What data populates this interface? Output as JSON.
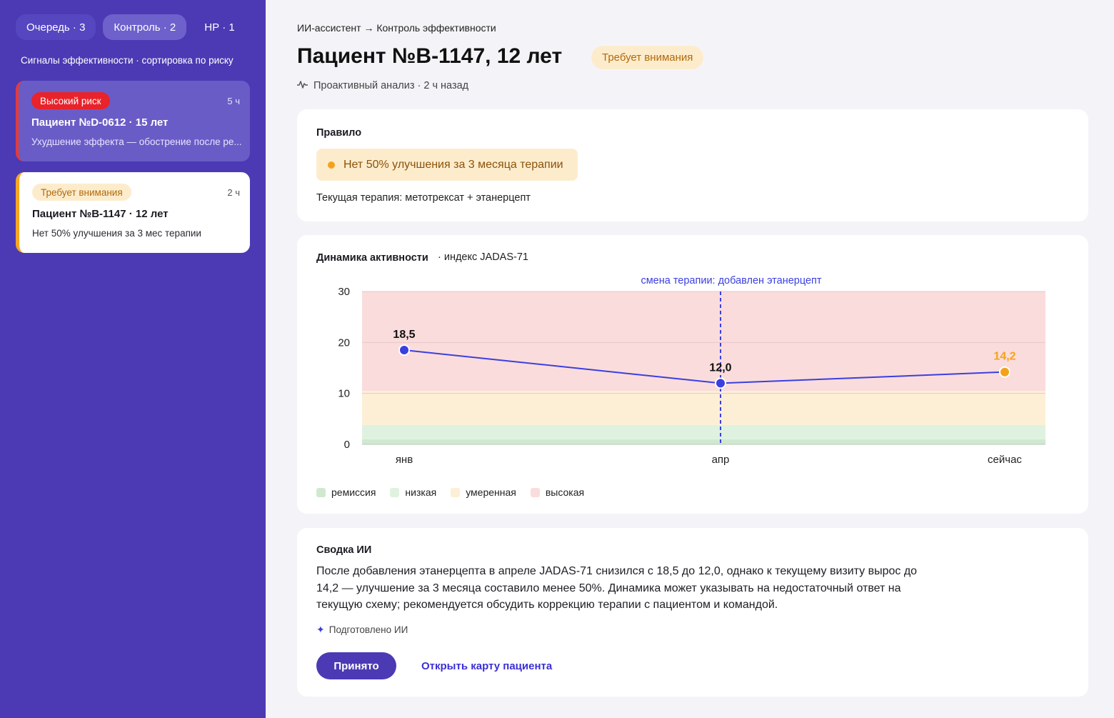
{
  "sidebar": {
    "tabs": [
      {
        "label": "Очередь · 3"
      },
      {
        "label": "Контроль · 2"
      },
      {
        "label": "НР · 1"
      }
    ],
    "subtitle": "Сигналы эффективности · сортировка по риску",
    "cards": [
      {
        "badge": "Высокий риск",
        "time": "5 ч",
        "title": "Пациент №D-0612 · 15 лет",
        "desc": "Ухудшение эффекта — обострение после ре..."
      },
      {
        "badge": "Требует внимания",
        "time": "2 ч",
        "title": "Пациент №B-1147 · 12 лет",
        "desc": "Нет 50% улучшения за 3 мес терапии"
      }
    ]
  },
  "main": {
    "breadcrumb": "ИИ-ассистент → Контроль эффективности",
    "title": "Пациент №B-1147, 12 лет",
    "status_badge": "Требует внимания",
    "analysis": "Проактивный анализ · 2 ч назад",
    "rule": {
      "heading": "Правило",
      "text": "Нет 50% улучшения за 3 месяца терапии",
      "therapy": "Текущая терапия: метотрексат + этанерцепт"
    },
    "chart_panel": {
      "heading": "Динамика активности",
      "subheading": "· индекс JADAS-71"
    },
    "summary": {
      "heading": "Сводка ИИ",
      "text": "После добавления этанерцепта в апреле JADAS-71 снизился с 18,5 до 12,0, однако к текущему визиту вырос до 14,2 — улучшение за 3 месяца составило менее 50%. Динамика может указывать на недостаточный ответ на текущую схему; рекомендуется обсудить коррекцию терапии с пациентом и командой.",
      "note": "Подготовлено ИИ",
      "accept_label": "Принято",
      "open_label": "Открыть карту пациента"
    }
  },
  "colors": {
    "sidebar": "#4b3ab4",
    "accent": "#3b3fe0",
    "warning": "#f5a21b",
    "danger": "#e8232a"
  },
  "chart_data": {
    "type": "line",
    "title": "Динамика активности",
    "ylabel": "",
    "xlabel": "",
    "categories": [
      "янв",
      "апр",
      "сейчас"
    ],
    "values": [
      18.5,
      12.0,
      14.2
    ],
    "value_labels": [
      "18,5",
      "12,0",
      "14,2"
    ],
    "ylim": [
      0,
      30
    ],
    "yticks": [
      "0",
      "10",
      "20",
      "30"
    ],
    "bands": [
      {
        "name": "ремиссия",
        "from": 0,
        "to": 1,
        "color": "#cfe9cf"
      },
      {
        "name": "низкая",
        "from": 1,
        "to": 3.8,
        "color": "#dff2e0"
      },
      {
        "name": "умеренная",
        "from": 3.8,
        "to": 10.5,
        "color": "#fcefd6"
      },
      {
        "name": "высокая",
        "from": 10.5,
        "to": 30,
        "color": "#fadcdc"
      }
    ],
    "annotation": {
      "text": "смена терапии: добавлен этанерцепт",
      "at_category": "апр"
    },
    "last_point_color": "#f5a21b",
    "point_color": "#3b3fe0"
  }
}
